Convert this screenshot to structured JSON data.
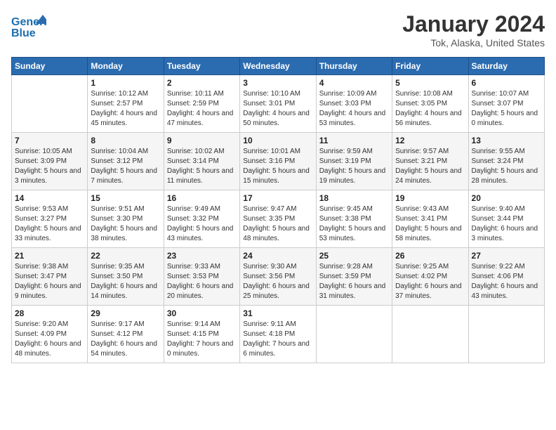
{
  "header": {
    "logo_line1": "General",
    "logo_line2": "Blue",
    "main_title": "January 2024",
    "subtitle": "Tok, Alaska, United States"
  },
  "weekdays": [
    "Sunday",
    "Monday",
    "Tuesday",
    "Wednesday",
    "Thursday",
    "Friday",
    "Saturday"
  ],
  "weeks": [
    [
      {
        "day": "",
        "info": ""
      },
      {
        "day": "1",
        "info": "Sunrise: 10:12 AM\nSunset: 2:57 PM\nDaylight: 4 hours\nand 45 minutes."
      },
      {
        "day": "2",
        "info": "Sunrise: 10:11 AM\nSunset: 2:59 PM\nDaylight: 4 hours\nand 47 minutes."
      },
      {
        "day": "3",
        "info": "Sunrise: 10:10 AM\nSunset: 3:01 PM\nDaylight: 4 hours\nand 50 minutes."
      },
      {
        "day": "4",
        "info": "Sunrise: 10:09 AM\nSunset: 3:03 PM\nDaylight: 4 hours\nand 53 minutes."
      },
      {
        "day": "5",
        "info": "Sunrise: 10:08 AM\nSunset: 3:05 PM\nDaylight: 4 hours\nand 56 minutes."
      },
      {
        "day": "6",
        "info": "Sunrise: 10:07 AM\nSunset: 3:07 PM\nDaylight: 5 hours\nand 0 minutes."
      }
    ],
    [
      {
        "day": "7",
        "info": "Sunrise: 10:05 AM\nSunset: 3:09 PM\nDaylight: 5 hours\nand 3 minutes."
      },
      {
        "day": "8",
        "info": "Sunrise: 10:04 AM\nSunset: 3:12 PM\nDaylight: 5 hours\nand 7 minutes."
      },
      {
        "day": "9",
        "info": "Sunrise: 10:02 AM\nSunset: 3:14 PM\nDaylight: 5 hours\nand 11 minutes."
      },
      {
        "day": "10",
        "info": "Sunrise: 10:01 AM\nSunset: 3:16 PM\nDaylight: 5 hours\nand 15 minutes."
      },
      {
        "day": "11",
        "info": "Sunrise: 9:59 AM\nSunset: 3:19 PM\nDaylight: 5 hours\nand 19 minutes."
      },
      {
        "day": "12",
        "info": "Sunrise: 9:57 AM\nSunset: 3:21 PM\nDaylight: 5 hours\nand 24 minutes."
      },
      {
        "day": "13",
        "info": "Sunrise: 9:55 AM\nSunset: 3:24 PM\nDaylight: 5 hours\nand 28 minutes."
      }
    ],
    [
      {
        "day": "14",
        "info": "Sunrise: 9:53 AM\nSunset: 3:27 PM\nDaylight: 5 hours\nand 33 minutes."
      },
      {
        "day": "15",
        "info": "Sunrise: 9:51 AM\nSunset: 3:30 PM\nDaylight: 5 hours\nand 38 minutes."
      },
      {
        "day": "16",
        "info": "Sunrise: 9:49 AM\nSunset: 3:32 PM\nDaylight: 5 hours\nand 43 minutes."
      },
      {
        "day": "17",
        "info": "Sunrise: 9:47 AM\nSunset: 3:35 PM\nDaylight: 5 hours\nand 48 minutes."
      },
      {
        "day": "18",
        "info": "Sunrise: 9:45 AM\nSunset: 3:38 PM\nDaylight: 5 hours\nand 53 minutes."
      },
      {
        "day": "19",
        "info": "Sunrise: 9:43 AM\nSunset: 3:41 PM\nDaylight: 5 hours\nand 58 minutes."
      },
      {
        "day": "20",
        "info": "Sunrise: 9:40 AM\nSunset: 3:44 PM\nDaylight: 6 hours\nand 3 minutes."
      }
    ],
    [
      {
        "day": "21",
        "info": "Sunrise: 9:38 AM\nSunset: 3:47 PM\nDaylight: 6 hours\nand 9 minutes."
      },
      {
        "day": "22",
        "info": "Sunrise: 9:35 AM\nSunset: 3:50 PM\nDaylight: 6 hours\nand 14 minutes."
      },
      {
        "day": "23",
        "info": "Sunrise: 9:33 AM\nSunset: 3:53 PM\nDaylight: 6 hours\nand 20 minutes."
      },
      {
        "day": "24",
        "info": "Sunrise: 9:30 AM\nSunset: 3:56 PM\nDaylight: 6 hours\nand 25 minutes."
      },
      {
        "day": "25",
        "info": "Sunrise: 9:28 AM\nSunset: 3:59 PM\nDaylight: 6 hours\nand 31 minutes."
      },
      {
        "day": "26",
        "info": "Sunrise: 9:25 AM\nSunset: 4:02 PM\nDaylight: 6 hours\nand 37 minutes."
      },
      {
        "day": "27",
        "info": "Sunrise: 9:22 AM\nSunset: 4:06 PM\nDaylight: 6 hours\nand 43 minutes."
      }
    ],
    [
      {
        "day": "28",
        "info": "Sunrise: 9:20 AM\nSunset: 4:09 PM\nDaylight: 6 hours\nand 48 minutes."
      },
      {
        "day": "29",
        "info": "Sunrise: 9:17 AM\nSunset: 4:12 PM\nDaylight: 6 hours\nand 54 minutes."
      },
      {
        "day": "30",
        "info": "Sunrise: 9:14 AM\nSunset: 4:15 PM\nDaylight: 7 hours\nand 0 minutes."
      },
      {
        "day": "31",
        "info": "Sunrise: 9:11 AM\nSunset: 4:18 PM\nDaylight: 7 hours\nand 6 minutes."
      },
      {
        "day": "",
        "info": ""
      },
      {
        "day": "",
        "info": ""
      },
      {
        "day": "",
        "info": ""
      }
    ]
  ]
}
